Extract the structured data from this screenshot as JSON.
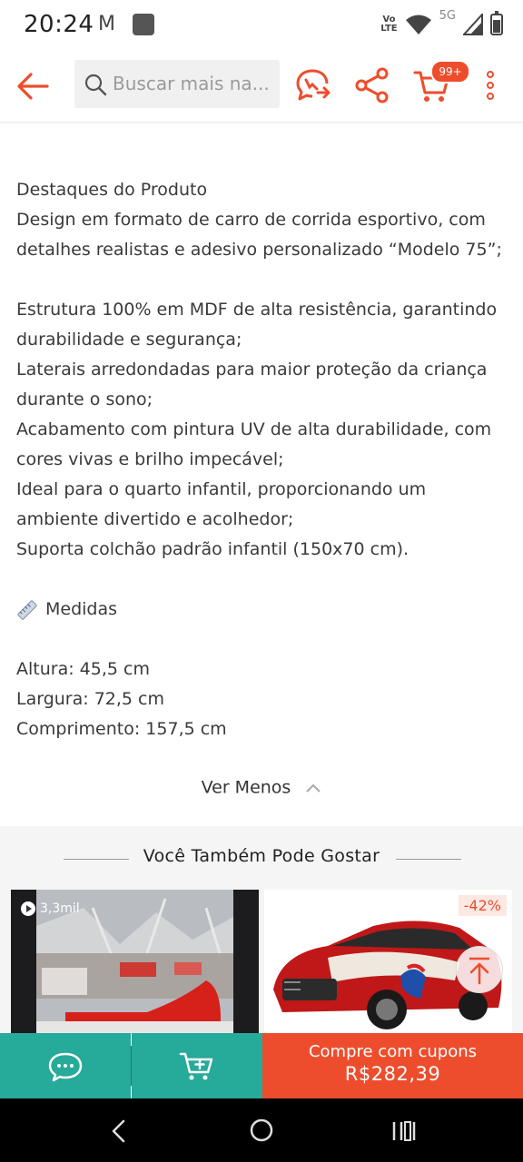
{
  "status_bar": {
    "time": "20:24",
    "mail_glyph": "M",
    "volte_line1": "Vo",
    "volte_line2": "LTE",
    "network": "5G"
  },
  "header": {
    "search_placeholder": "Buscar mais na...",
    "cart_badge": "99+",
    "icons": [
      "back-arrow-icon",
      "search-icon",
      "chat-share-icon",
      "share-icon",
      "cart-icon",
      "more-vertical-icon"
    ],
    "accent_color": "#ee4d2d"
  },
  "description": {
    "lines": [
      "Destaques do Produto",
      "Design em formato de carro de corrida esportivo, com",
      "detalhes realistas e adesivo personalizado “Modelo 75”;",
      "",
      "Estrutura 100% em MDF de alta resistência, garantindo",
      "durabilidade e segurança;",
      "Laterais arredondadas para maior proteção da criança",
      "durante o sono;",
      "Acabamento com pintura UV de alta durabilidade, com",
      "cores vivas e brilho impecável;",
      "Ideal para o quarto infantil, proporcionando um",
      "ambiente divertido e acolhedor;",
      "Suporta colchão padrão infantil (150x70 cm)."
    ],
    "measures_heading": "Medidas",
    "measures": [
      "Altura: 45,5 cm",
      "Largura: 72,5 cm",
      "Comprimento: 157,5 cm"
    ]
  },
  "toggle": {
    "label": "Ver Menos"
  },
  "recommendations": {
    "title": "Você Também Pode Gostar",
    "cards": [
      {
        "views": "3,3mil"
      },
      {
        "discount": "-42%"
      }
    ]
  },
  "bottom_bar": {
    "buy_label": "Compre com cupons",
    "buy_price": "R$282,39",
    "chat_color": "#26aa99",
    "buy_color": "#ee4d2d"
  }
}
